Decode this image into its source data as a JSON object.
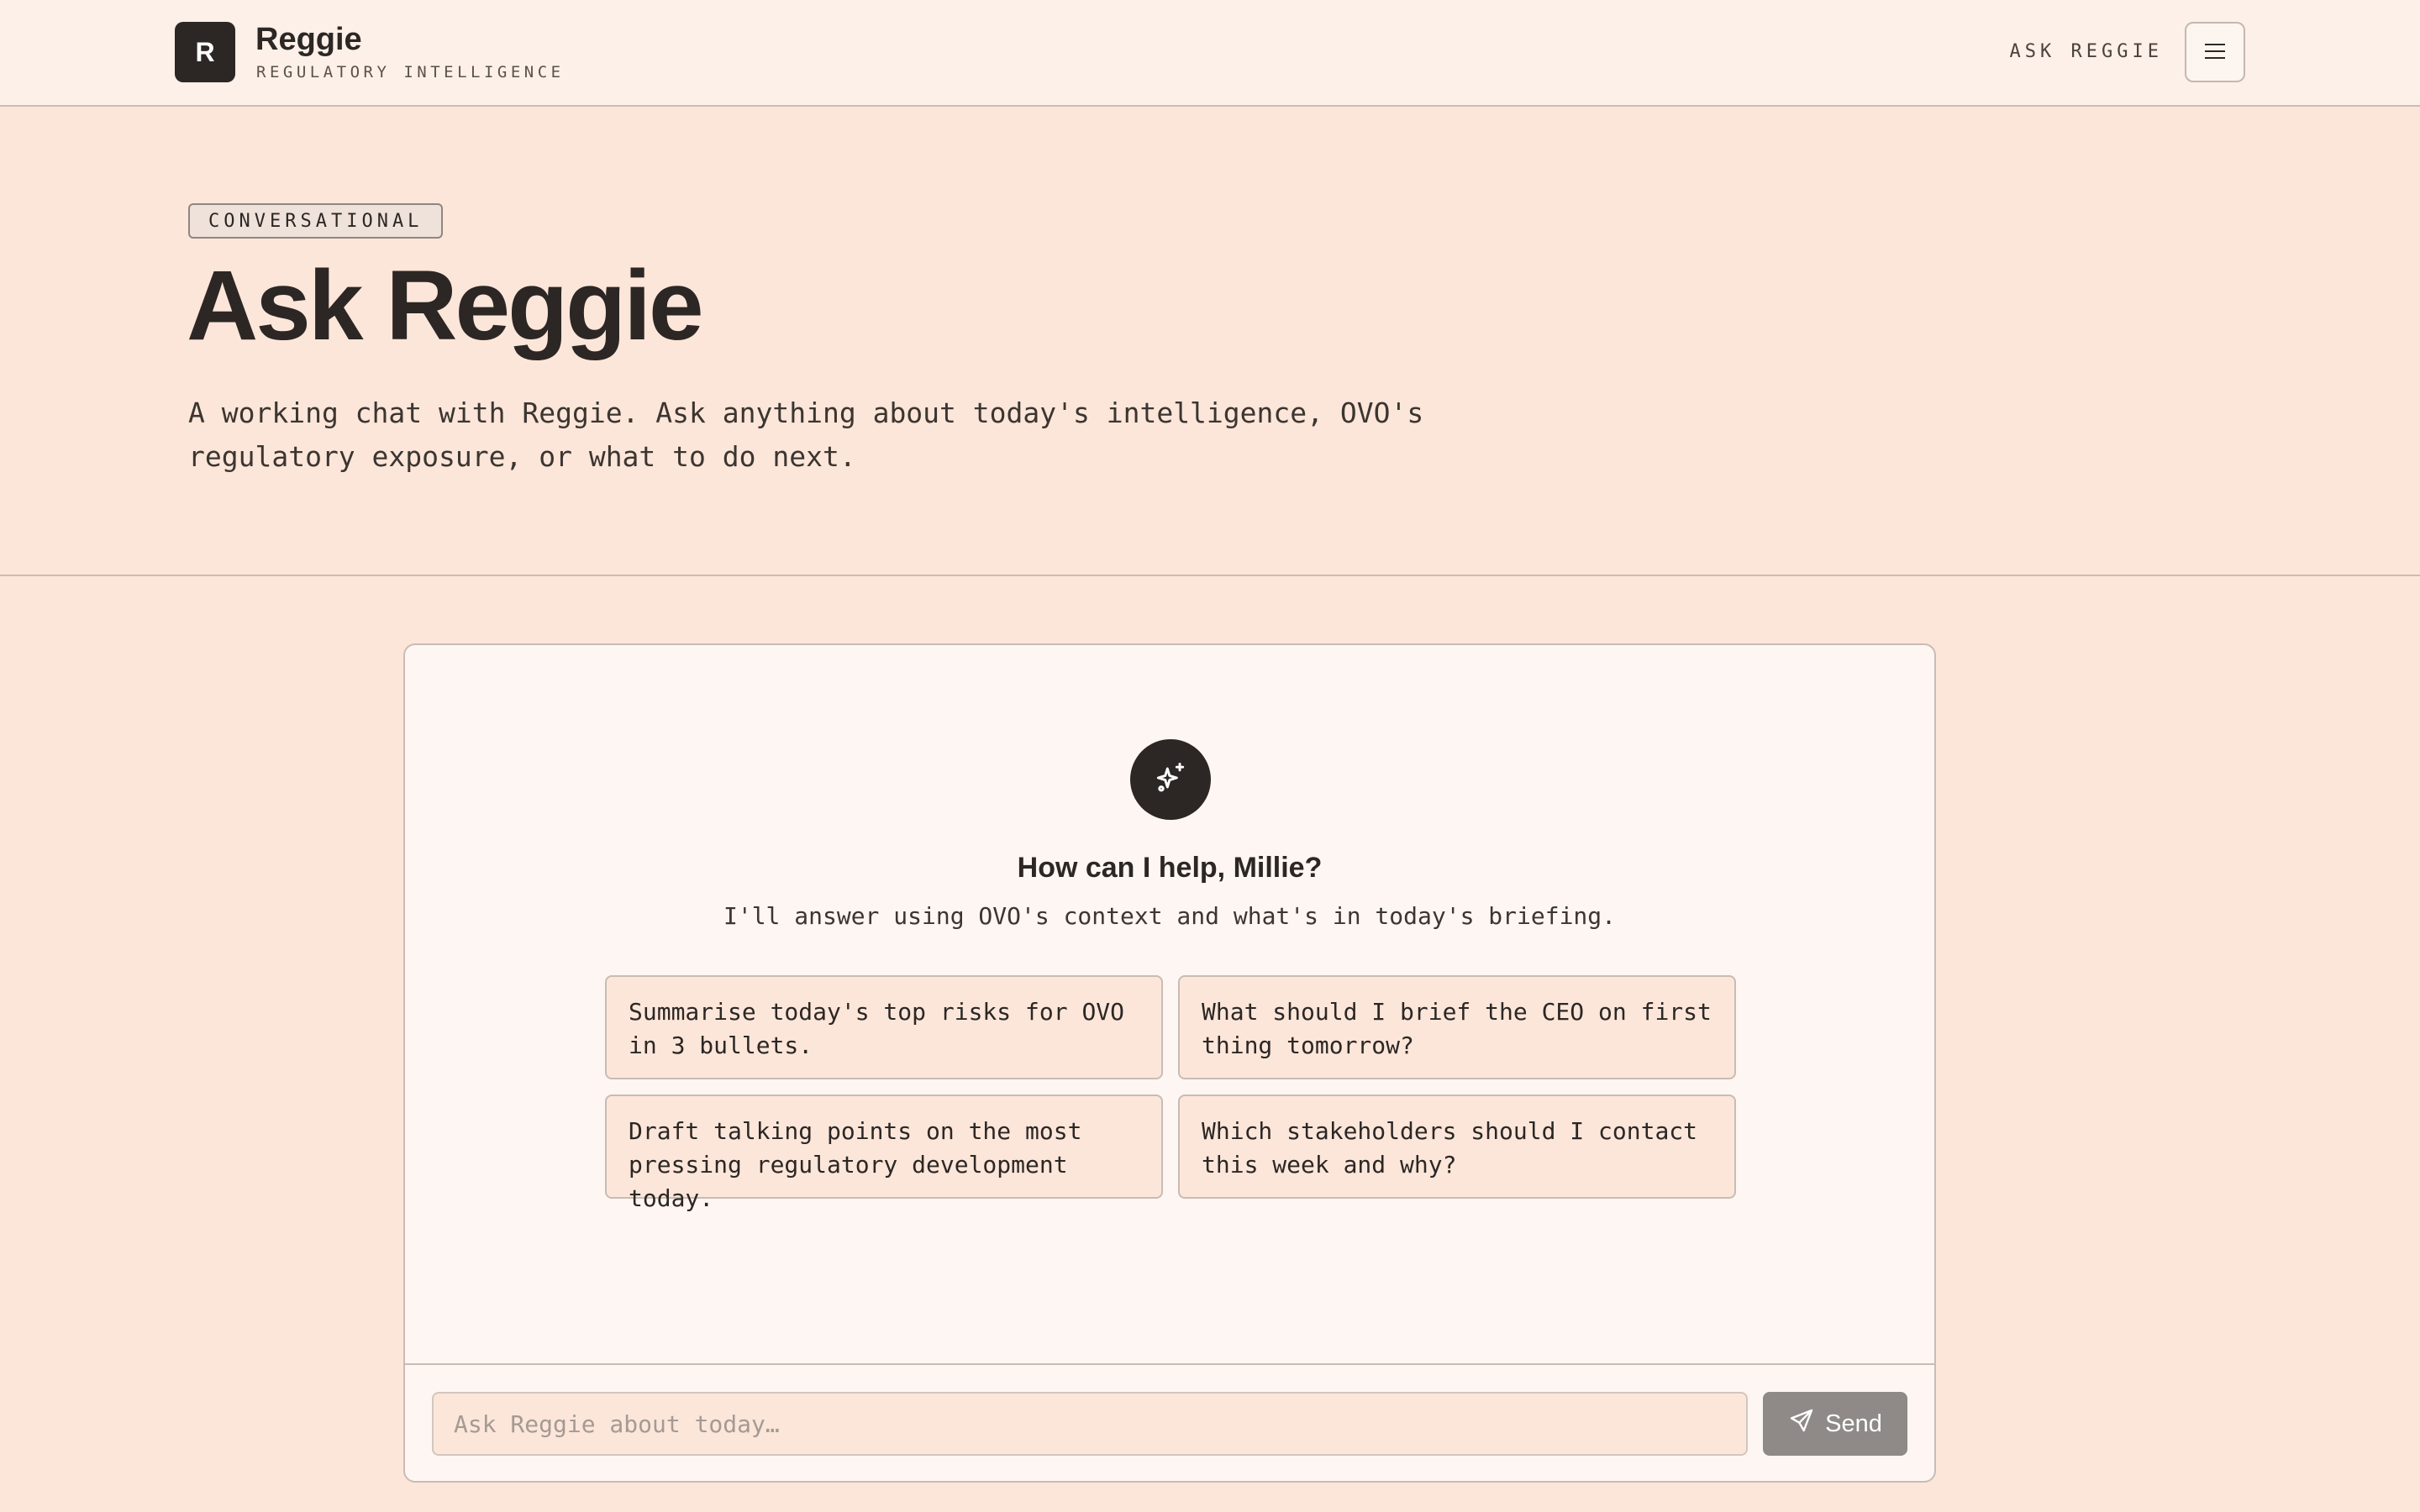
{
  "header": {
    "logo_letter": "R",
    "brand_name": "Reggie",
    "brand_subtitle": "REGULATORY INTELLIGENCE",
    "nav_link": "ASK REGGIE",
    "menu_icon": "hamburger-icon"
  },
  "hero": {
    "tag": "CONVERSATIONAL",
    "title": "Ask Reggie",
    "description": "A working chat with Reggie. Ask anything about today's intelligence, OVO's regulatory exposure, or what to do next."
  },
  "chat": {
    "avatar_icon": "sparkles-icon",
    "welcome_title": "How can I help, Millie?",
    "welcome_subtitle": "I'll answer using OVO's context and what's in today's briefing.",
    "suggestions": [
      "Summarise today's top risks for OVO in 3 bullets.",
      "What should I brief the CEO on first thing tomorrow?",
      "Draft talking points on the most pressing regulatory development today.",
      "Which stakeholders should I contact this week and why?"
    ],
    "input_placeholder": "Ask Reggie about today…",
    "send_label": "Send",
    "send_icon": "send-icon"
  },
  "colors": {
    "background": "#fce6da",
    "header_bg": "#fdf0e8",
    "card_bg": "#fdf6f2",
    "dark": "#2c2724",
    "send_button": "#8f8a87"
  }
}
